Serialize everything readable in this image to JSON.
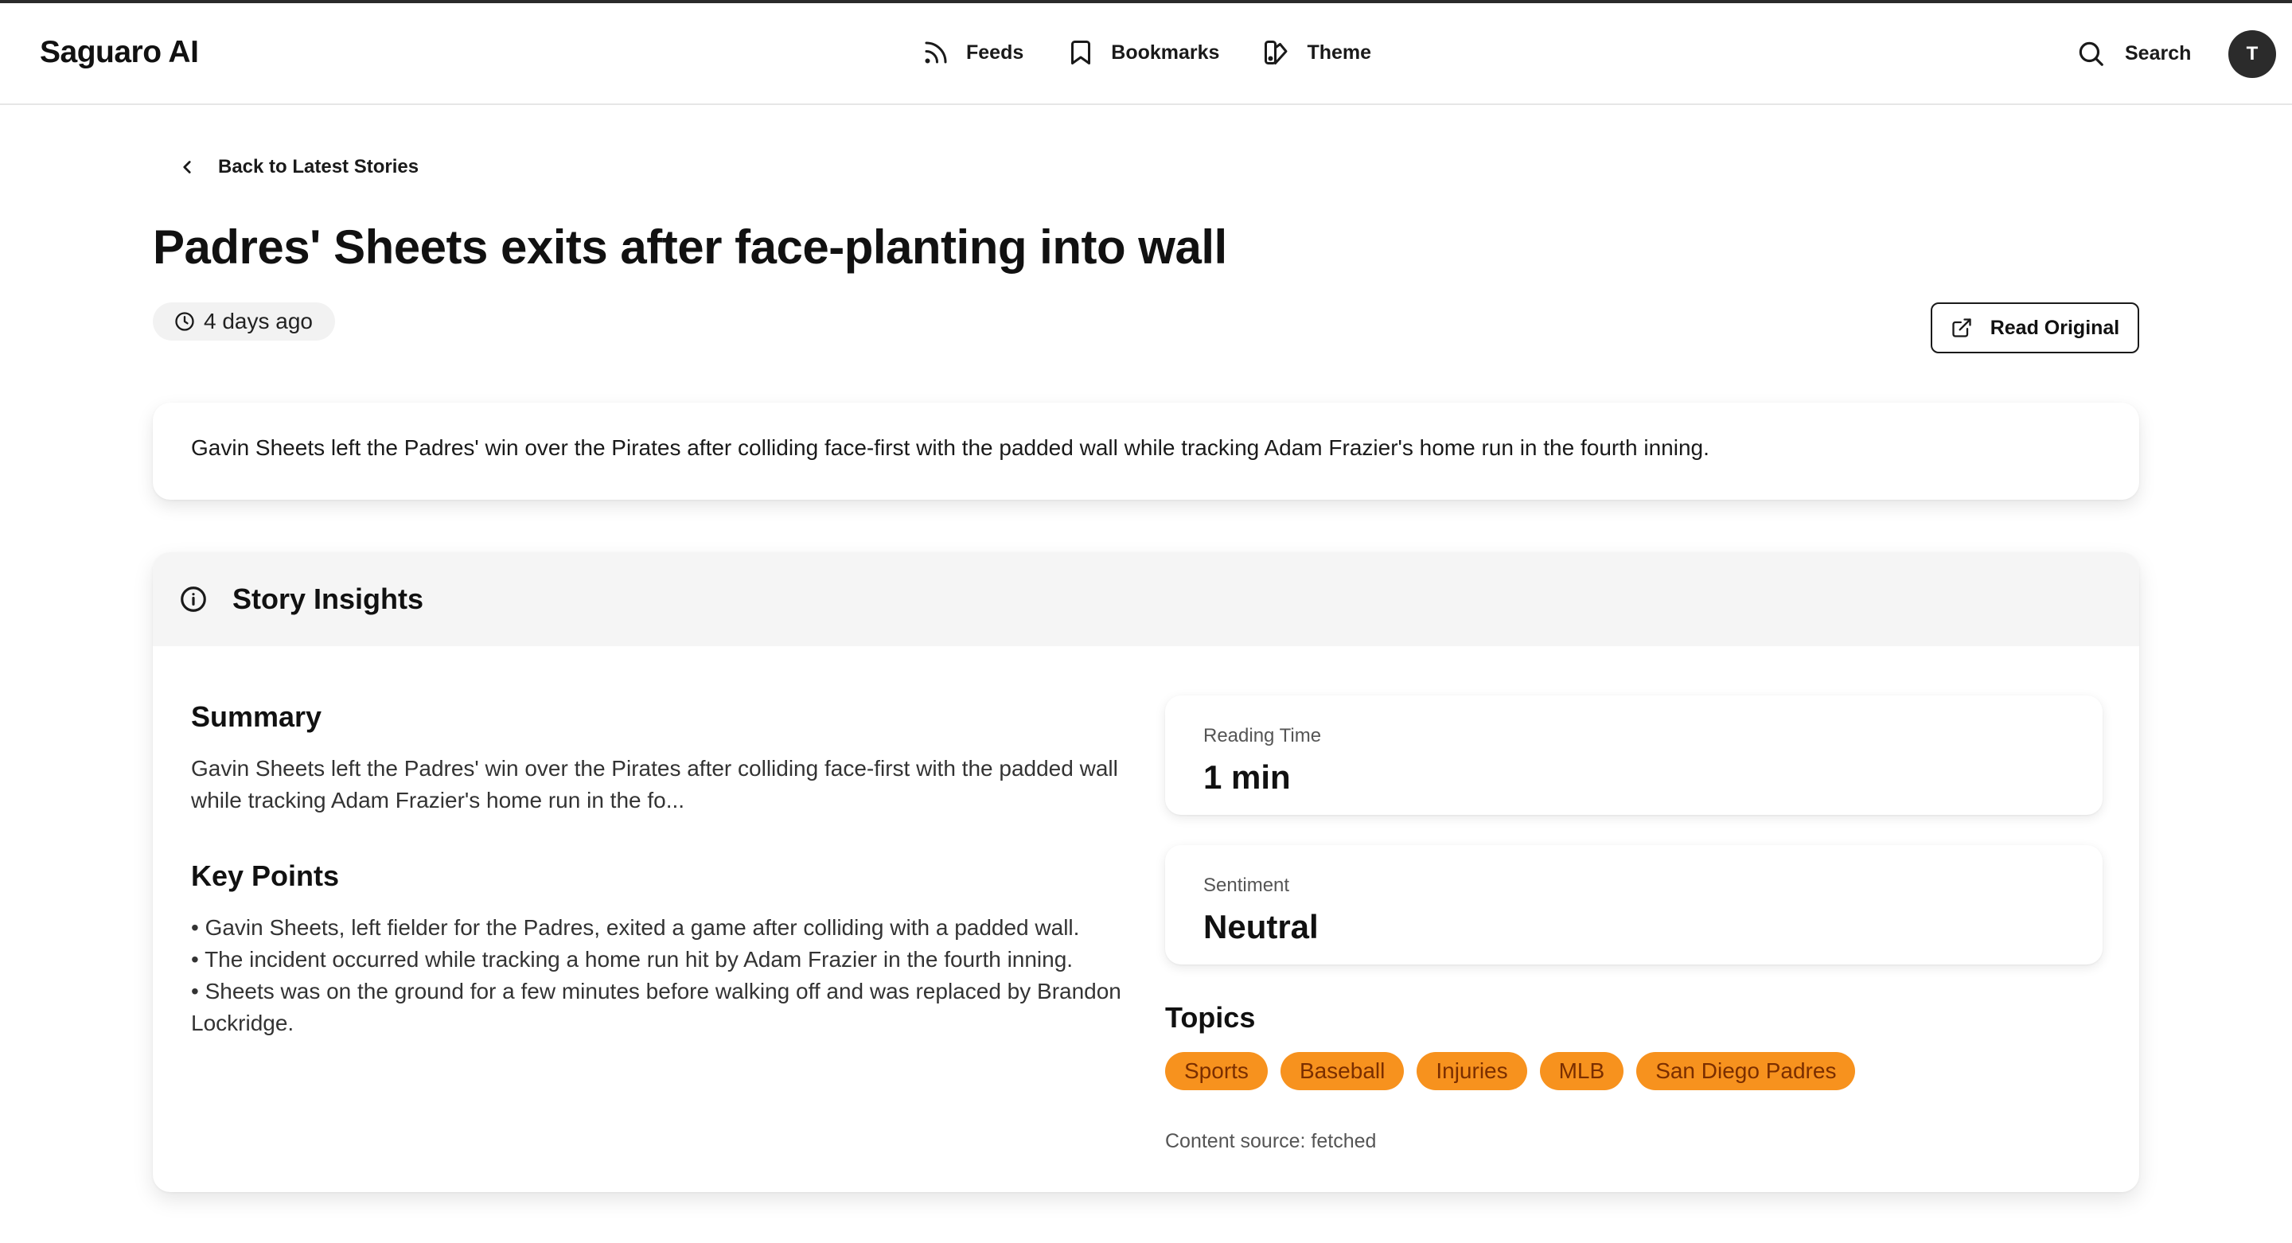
{
  "header": {
    "brand": "Saguaro AI",
    "nav": [
      {
        "label": "Feeds",
        "icon": "rss-icon"
      },
      {
        "label": "Bookmarks",
        "icon": "bookmark-icon"
      },
      {
        "label": "Theme",
        "icon": "theme-icon"
      }
    ],
    "search_label": "Search",
    "avatar_initial": "T"
  },
  "back_link": "Back to Latest Stories",
  "article": {
    "title": "Padres' Sheets exits after face-planting into wall",
    "time_ago": "4 days ago",
    "read_original": "Read Original",
    "description": "Gavin Sheets left the Padres' win over the Pirates after colliding face-first with the padded wall while tracking Adam Frazier's home run in the fourth inning."
  },
  "insights": {
    "title": "Story Insights",
    "summary_title": "Summary",
    "summary_text": "Gavin Sheets left the Padres' win over the Pirates after colliding face-first with the padded wall while tracking Adam Frazier's home run in the fo...",
    "key_points_title": "Key Points",
    "key_points": [
      "• Gavin Sheets, left fielder for the Padres, exited a game after colliding with a padded wall.",
      "• The incident occurred while tracking a home run hit by Adam Frazier in the fourth inning.",
      "• Sheets was on the ground for a few minutes before walking off and was replaced by Brandon Lockridge."
    ],
    "reading_time_label": "Reading Time",
    "reading_time_value": "1 min",
    "sentiment_label": "Sentiment",
    "sentiment_value": "Neutral",
    "topics_title": "Topics",
    "topics": [
      "Sports",
      "Baseball",
      "Injuries",
      "MLB",
      "San Diego Padres"
    ],
    "content_source": "Content source: fetched"
  },
  "colors": {
    "topic_chip_bg": "#f7921e",
    "topic_chip_text": "#7a2e00",
    "avatar_bg": "#2b2b2b"
  }
}
